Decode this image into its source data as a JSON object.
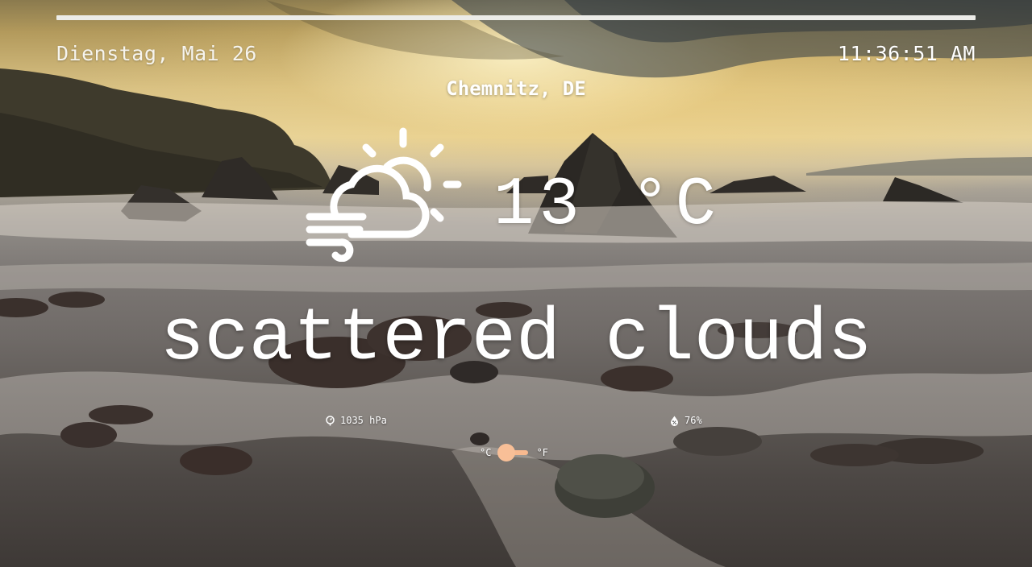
{
  "header": {
    "date": "Dienstag, Mai 26",
    "time": "11:36:51 AM"
  },
  "location": "Chemnitz, DE",
  "weather": {
    "icon": "partly-cloudy-windy-icon",
    "temperature": "13 °C",
    "description": "scattered clouds",
    "pressure": "1035 hPa",
    "humidity": "76%"
  },
  "unit_toggle": {
    "celsius_label": "°C",
    "fahrenheit_label": "°F",
    "selected": "°C"
  },
  "colors": {
    "text": "#ffffff",
    "toggle_accent": "#f8bf97"
  }
}
